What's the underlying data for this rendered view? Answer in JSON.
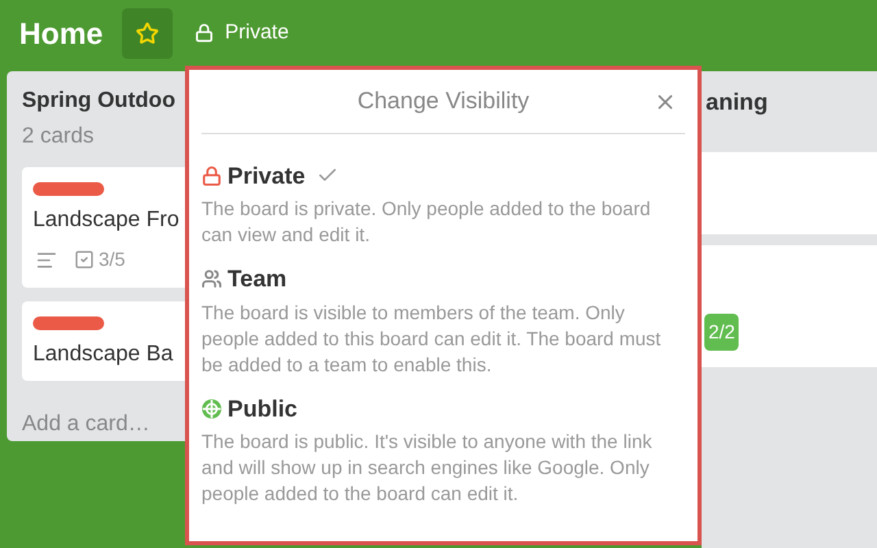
{
  "header": {
    "title": "Home",
    "starred": true,
    "visibility": "Private"
  },
  "left_list": {
    "title": "Spring Outdoo",
    "count": "2 cards",
    "add_card": "Add a card…",
    "cards": [
      {
        "color": "#eb5a46",
        "title": "Landscape Fro",
        "has_description": true,
        "checklist": "3/5"
      },
      {
        "color": "#eb5a46",
        "title": "Landscape Ba"
      }
    ]
  },
  "right_list": {
    "title": "aning",
    "cards": [
      {
        "kind": "plain"
      },
      {
        "kind": "checklist",
        "checklist": "2/2",
        "checklist_done": true
      }
    ]
  },
  "popup": {
    "title": "Change Visibility",
    "options": [
      {
        "kind": "private",
        "name": "Private",
        "selected": true,
        "description": "The board is private. Only people added to the board can view and edit it."
      },
      {
        "kind": "team",
        "name": "Team",
        "selected": false,
        "description": "The board is visible to members of the team. Only people added to this board can edit it. The board must be added to a team to enable this."
      },
      {
        "kind": "public",
        "name": "Public",
        "selected": false,
        "description": "The board is public. It's visible to anyone with the link and will show up in search engines like Google. Only people added to the board can edit it."
      }
    ]
  }
}
